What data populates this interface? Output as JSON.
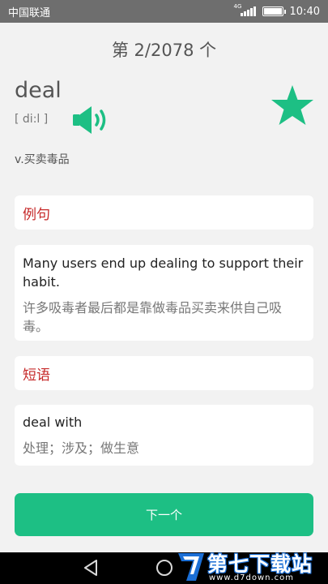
{
  "status_bar": {
    "carrier": "中国联通",
    "network": "4G",
    "time": "10:40"
  },
  "counter": "第 2/2078 个",
  "word": {
    "text": "deal",
    "phonetic": "[ di:l ]",
    "meaning": "v.买卖毒品",
    "favorited": true
  },
  "example": {
    "title": "例句",
    "english": "Many users end up dealing to support their habit.",
    "chinese": "许多吸毒者最后都是靠做毒品买卖来供自己吸毒。"
  },
  "phrase": {
    "title": "短语",
    "english": "deal with",
    "chinese": "处理；涉及；做生意"
  },
  "next_button": "下一个",
  "watermark": {
    "title": "第七下载站",
    "url": "www.d7down.com"
  },
  "colors": {
    "accent": "#1dbf84",
    "section_title": "#c62828",
    "status_bar": "#6e6e6e"
  },
  "icons": [
    "speaker-icon",
    "star-icon",
    "back-icon",
    "home-icon"
  ]
}
